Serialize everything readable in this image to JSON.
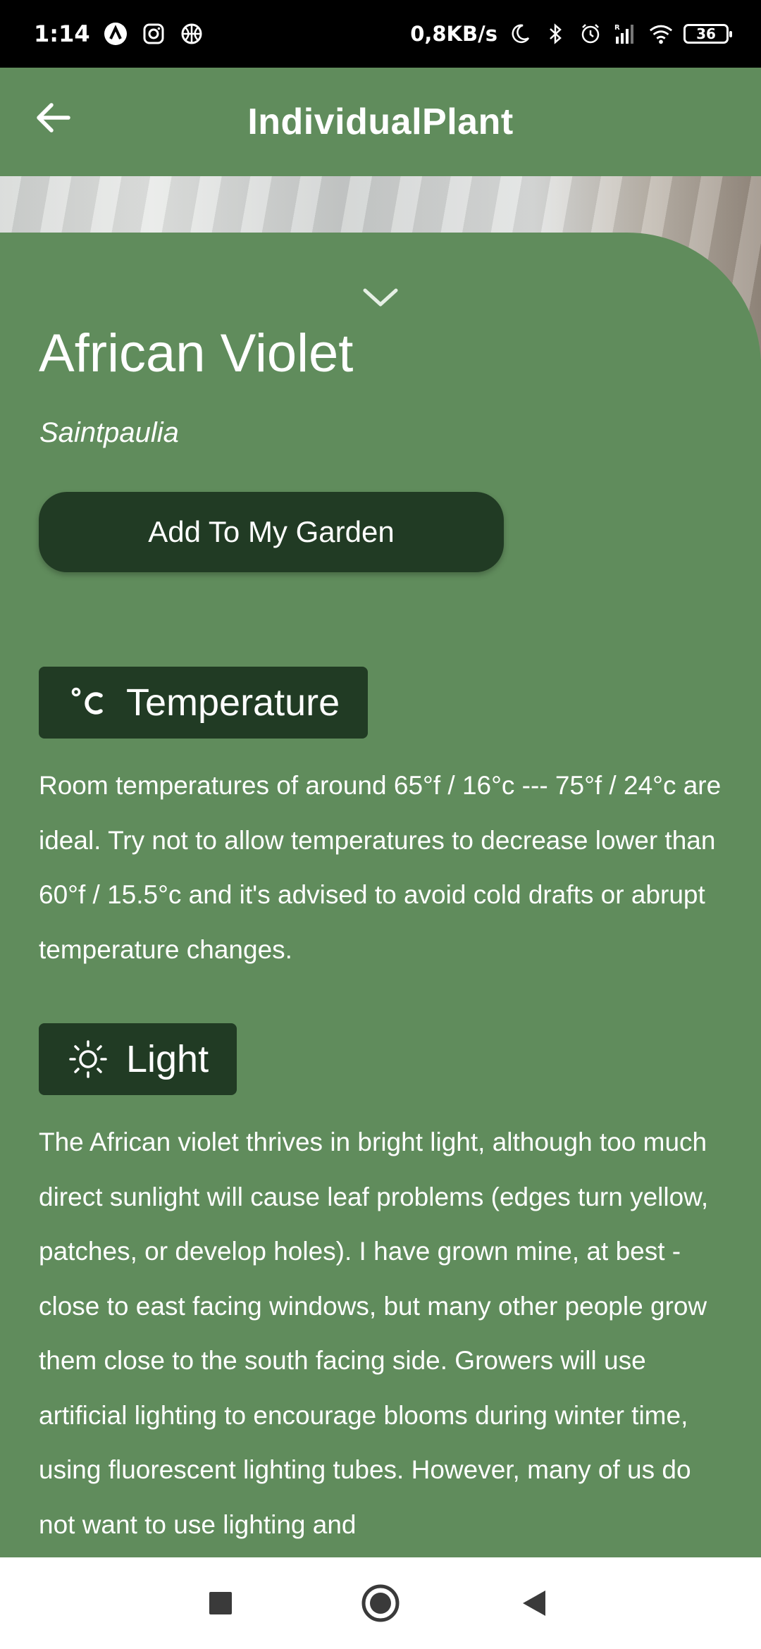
{
  "status_bar": {
    "time": "1:14",
    "net_speed": "0,8KB/s",
    "battery": "36",
    "left_icons": [
      "a-circle-icon",
      "instagram-icon",
      "basketball-icon"
    ],
    "right_icons": [
      "moon-icon",
      "bluetooth-icon",
      "alarm-icon",
      "signal-icon",
      "wifi-icon",
      "battery-icon"
    ]
  },
  "app_bar": {
    "title": "IndividualPlant",
    "back_icon": "arrow-left-icon"
  },
  "plant": {
    "name": "African Violet",
    "scientific_name": "Saintpaulia",
    "add_button_label": "Add To My Garden"
  },
  "sections": {
    "temperature": {
      "icon": "celsius-icon",
      "title": "Temperature",
      "text": "Room temperatures of around 65°f / 16°c --- 75°f / 24°c are ideal. Try not to allow temperatures to decrease lower than 60°f / 15.5°c and it's advised to avoid cold drafts or abrupt temperature changes."
    },
    "light": {
      "icon": "sun-icon",
      "title": "Light",
      "text": "The African violet thrives in bright light, although too much direct sunlight will cause leaf problems (edges turn yellow, patches, or develop holes). I have grown mine, at best - close to east facing windows, but many other people grow them close to the south facing side. Growers will use artificial lighting to encourage blooms during winter time, using fluorescent lighting tubes. However, many of us do not want to use lighting and"
    }
  },
  "colors": {
    "background": "#608c5c",
    "chip": "#213b24",
    "button": "#213b24",
    "status_bar": "#000000",
    "nav_bar": "#ffffff"
  },
  "nav_bar": {
    "icons": [
      "recents-square-icon",
      "home-circle-icon",
      "back-triangle-icon"
    ]
  }
}
